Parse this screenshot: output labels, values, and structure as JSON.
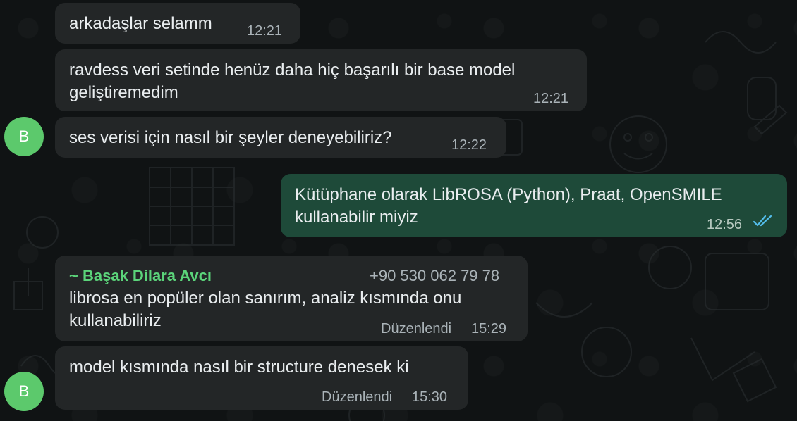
{
  "colors": {
    "background": "#101314",
    "incoming_bubble": "#232627",
    "outgoing_bubble": "#1e4a39",
    "sender_name": "#5bd47a",
    "avatar": "#5cc96c",
    "read_ticks": "#53bdeb"
  },
  "messages": [
    {
      "direction": "incoming",
      "lines": [
        "arkadaşlar selamm"
      ],
      "time": "12:21"
    },
    {
      "direction": "incoming",
      "lines": [
        "ravdess veri setinde henüz daha hiç başarılı bir base model",
        "geliştiremedim"
      ],
      "time": "12:21"
    },
    {
      "direction": "incoming",
      "lines": [
        "ses verisi için nasıl bir şeyler deneyebiliriz?"
      ],
      "time": "12:22",
      "avatar": "B"
    },
    {
      "direction": "outgoing",
      "lines": [
        "Kütüphane olarak LibROSA (Python), Praat, OpenSMILE",
        "kullanabilir miyiz"
      ],
      "time": "12:56",
      "status_icon": "double-check-read-icon"
    },
    {
      "direction": "incoming",
      "sender": "~ Başak Dilara Avcı",
      "phone": "+90 530 062 79 78",
      "lines": [
        "librosa en popüler olan sanırım, analiz kısmında onu",
        "kullanabiliriz"
      ],
      "edited": "Düzenlendi",
      "time": "15:29"
    },
    {
      "direction": "incoming",
      "lines": [
        "model kısmında nasıl bir structure denesek ki"
      ],
      "edited": "Düzenlendi",
      "time": "15:30",
      "avatar": "B"
    }
  ]
}
